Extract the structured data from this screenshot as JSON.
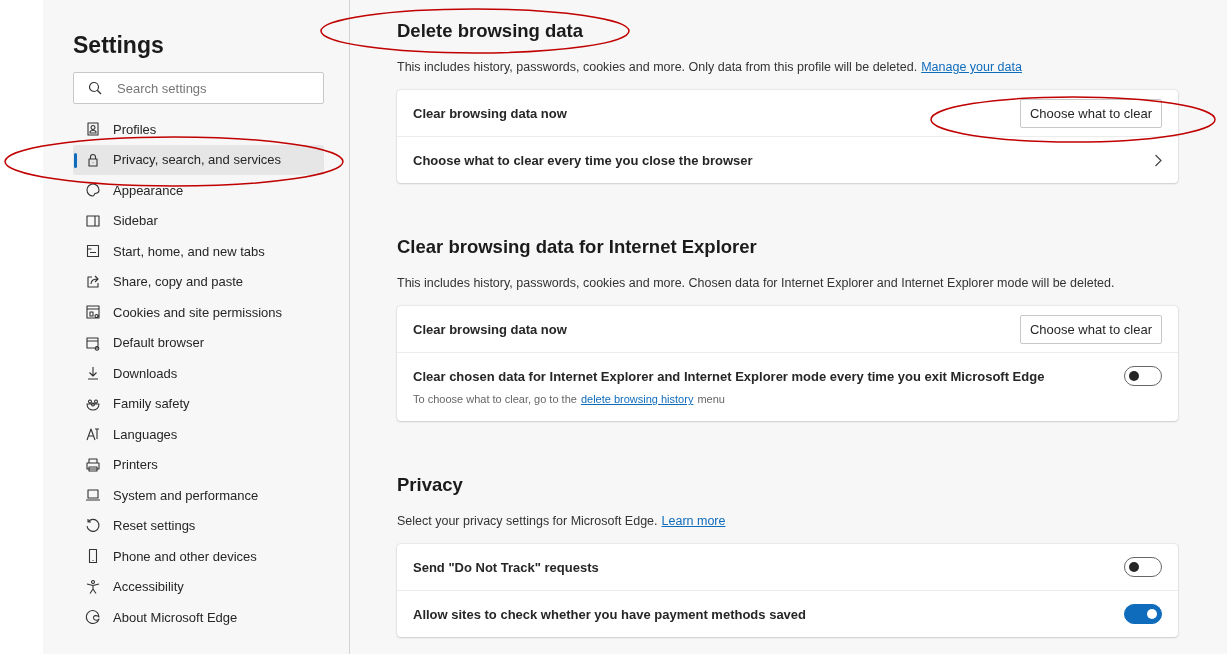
{
  "sidebar": {
    "title": "Settings",
    "search": {
      "placeholder": "Search settings"
    },
    "items": [
      {
        "label": "Profiles",
        "selected": false
      },
      {
        "label": "Privacy, search, and services",
        "selected": true
      },
      {
        "label": "Appearance",
        "selected": false
      },
      {
        "label": "Sidebar",
        "selected": false
      },
      {
        "label": "Start, home, and new tabs",
        "selected": false
      },
      {
        "label": "Share, copy and paste",
        "selected": false
      },
      {
        "label": "Cookies and site permissions",
        "selected": false
      },
      {
        "label": "Default browser",
        "selected": false
      },
      {
        "label": "Downloads",
        "selected": false
      },
      {
        "label": "Family safety",
        "selected": false
      },
      {
        "label": "Languages",
        "selected": false
      },
      {
        "label": "Printers",
        "selected": false
      },
      {
        "label": "System and performance",
        "selected": false
      },
      {
        "label": "Reset settings",
        "selected": false
      },
      {
        "label": "Phone and other devices",
        "selected": false
      },
      {
        "label": "Accessibility",
        "selected": false
      },
      {
        "label": "About Microsoft Edge",
        "selected": false
      }
    ]
  },
  "sections": [
    {
      "title": "Delete browsing data",
      "description": {
        "text": "This includes history, passwords, cookies and more. Only data from this profile will be deleted.",
        "link": "Manage your data"
      },
      "rows": [
        {
          "kind": "button",
          "label": "Clear browsing data now",
          "button": "Choose what to clear"
        },
        {
          "kind": "chevron",
          "label": "Choose what to clear every time you close the browser"
        }
      ]
    },
    {
      "title": "Clear browsing data for Internet Explorer",
      "description": {
        "text": "This includes history, passwords, cookies and more. Chosen data for Internet Explorer and Internet Explorer mode will be deleted."
      },
      "rows": [
        {
          "kind": "button",
          "label": "Clear browsing data now",
          "button": "Choose what to clear"
        },
        {
          "kind": "toggle",
          "label": "Clear chosen data for Internet Explorer and Internet Explorer mode every time you exit Microsoft Edge",
          "on": false,
          "note": {
            "before": "To choose what to clear, go to the",
            "link": "delete browsing history",
            "after": "menu"
          }
        }
      ]
    },
    {
      "title": "Privacy",
      "description": {
        "text": "Select your privacy settings for Microsoft Edge.",
        "link": "Learn more"
      },
      "rows": [
        {
          "kind": "toggle",
          "label": "Send \"Do Not Track\" requests",
          "on": false
        },
        {
          "kind": "toggle",
          "label": "Allow sites to check whether you have payment methods saved",
          "on": true
        }
      ]
    }
  ]
}
